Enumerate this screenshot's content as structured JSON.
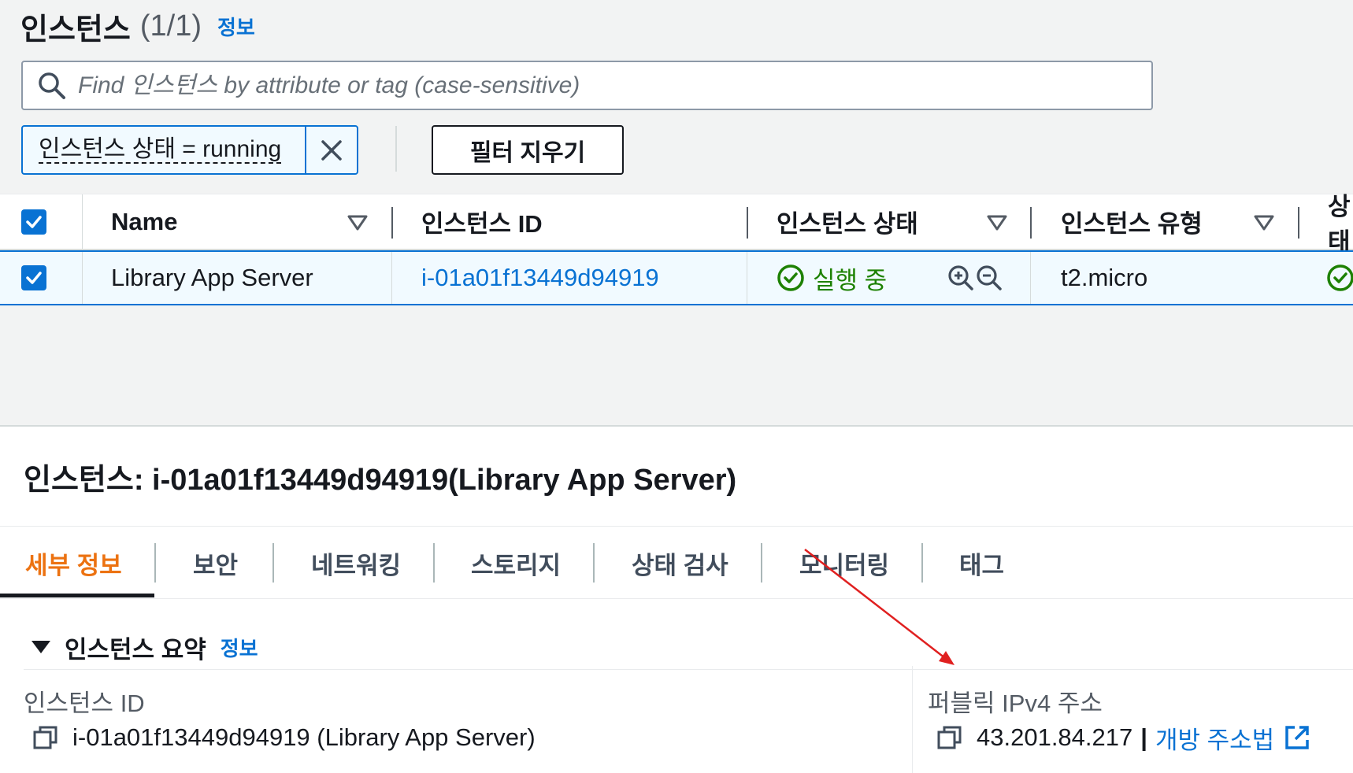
{
  "header": {
    "title": "인스턴스",
    "count": "(1/1)",
    "info_link": "정보"
  },
  "search": {
    "placeholder": "Find 인스턴스 by attribute or tag (case-sensitive)",
    "value": ""
  },
  "filter_token": {
    "label": "인스턴스 상태 = running"
  },
  "clear_filters_label": "필터 지우기",
  "table": {
    "columns": [
      {
        "label": "Name",
        "sortable": true
      },
      {
        "label": "인스턴스 ID",
        "sortable": false
      },
      {
        "label": "인스턴스 상태",
        "sortable": true
      },
      {
        "label": "인스턴스 유형",
        "sortable": true
      },
      {
        "label": "상태",
        "sortable": false
      }
    ],
    "rows": [
      {
        "name": "Library App Server",
        "instance_id": "i-01a01f13449d94919",
        "state": "실행 중",
        "type": "t2.micro"
      }
    ]
  },
  "detail": {
    "title": "인스턴스: i-01a01f13449d94919(Library App Server)",
    "tabs": [
      "세부 정보",
      "보안",
      "네트워킹",
      "스토리지",
      "상태 검사",
      "모니터링",
      "태그"
    ],
    "active_tab": "세부 정보",
    "section": {
      "title": "인스턴스 요약",
      "info_link": "정보"
    },
    "fields": {
      "instance_id_label": "인스턴스 ID",
      "instance_id_value": "i-01a01f13449d94919 (Library App Server)",
      "public_ipv4_label": "퍼블릭 IPv4 주소",
      "public_ipv4_value": "43.201.84.217",
      "separator": "|",
      "open_address_link": "개방 주소법"
    }
  },
  "colors": {
    "link": "#0972d3",
    "running": "#1d8102",
    "active_tab": "#ec7211",
    "annotation_arrow": "#e02020"
  }
}
